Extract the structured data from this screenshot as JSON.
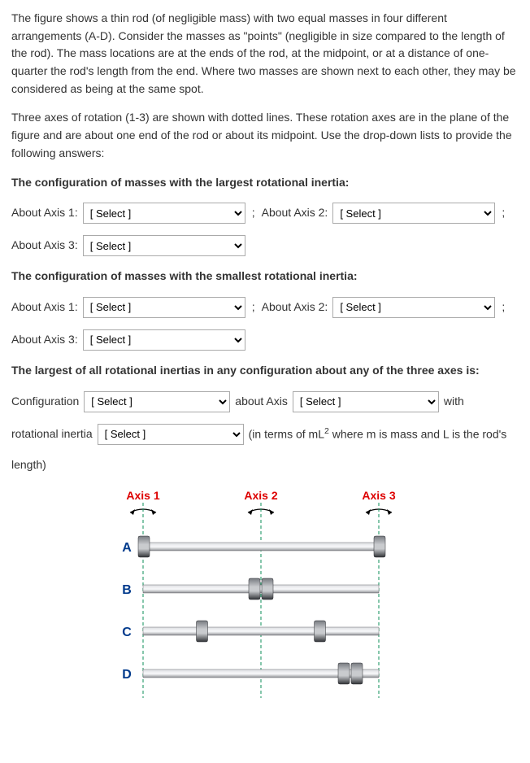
{
  "intro": {
    "p1": "The figure shows a thin rod (of negligible mass) with two equal masses in four different arrangements (A-D).  Consider the masses as \"points\" (negligible in size compared to the length of the rod).  The mass locations are at the ends of the rod, at the midpoint, or at a distance of one-quarter the rod's length from the end.  Where two masses are shown next to each other, they may be considered as being at the same spot.",
    "p2": "Three axes of rotation (1-3) are shown with dotted lines.  These rotation axes are in the plane of the figure and are about one end of the rod or about its midpoint.  Use the drop-down lists to provide the following answers:"
  },
  "section_largest": {
    "heading": "The configuration of masses with the largest rotational inertia:",
    "axis1_label": "About Axis 1:",
    "axis2_label": "About Axis 2:",
    "axis3_label": "About Axis 3:"
  },
  "section_smallest": {
    "heading": "The configuration of masses with the smallest rotational inertia:",
    "axis1_label": "About Axis 1:",
    "axis2_label": "About Axis 2:",
    "axis3_label": "About Axis 3:"
  },
  "section_overall": {
    "heading": "The largest of all rotational inertias in any configuration about any of the three axes is:",
    "config_label": "Configuration",
    "about_axis_text": "about Axis",
    "with_text": "with",
    "rot_inertia_label": "rotational inertia",
    "terms_prefix": "(in terms of mL",
    "terms_exp": "2",
    "terms_suffix": " where m is mass and L is the rod's",
    "length_text": "length)"
  },
  "placeholder": "[ Select ]",
  "punct": {
    "semicolon": ";"
  },
  "diagram": {
    "axis1": "Axis 1",
    "axis2": "Axis 2",
    "axis3": "Axis 3",
    "A": "A",
    "B": "B",
    "C": "C",
    "D": "D"
  }
}
